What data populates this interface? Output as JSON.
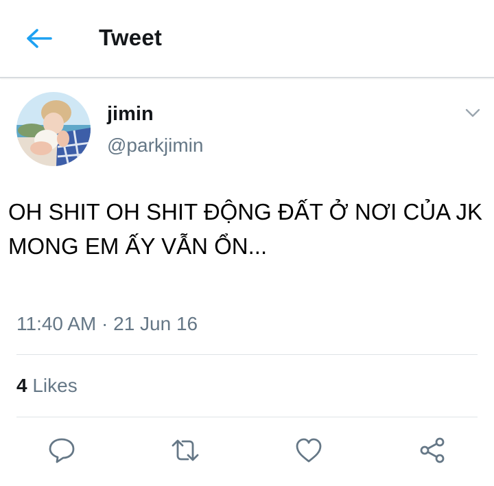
{
  "header": {
    "back_icon": "arrow-left-icon",
    "title": "Tweet"
  },
  "tweet": {
    "author": {
      "display_name": "jimin",
      "handle": "@parkjimin",
      "avatar": "profile-photo"
    },
    "menu_icon": "chevron-down-icon",
    "text": "OH SHIT OH SHIT ĐỘNG ĐẤT Ở NƠI CỦA JK\nMONG EM ẤY VẪN ỔN...",
    "time": "11:40 AM",
    "separator": "·",
    "date": "21 Jun 16",
    "likes_count": "4",
    "likes_label": "Likes"
  },
  "actions": [
    {
      "name": "reply",
      "icon": "reply-icon"
    },
    {
      "name": "retweet",
      "icon": "retweet-icon"
    },
    {
      "name": "like",
      "icon": "heart-icon"
    },
    {
      "name": "share",
      "icon": "share-icon"
    }
  ],
  "colors": {
    "accent": "#1da1f2",
    "secondary_text": "#657786",
    "icon_gray": "#657786",
    "divider": "#dfe3e6"
  }
}
